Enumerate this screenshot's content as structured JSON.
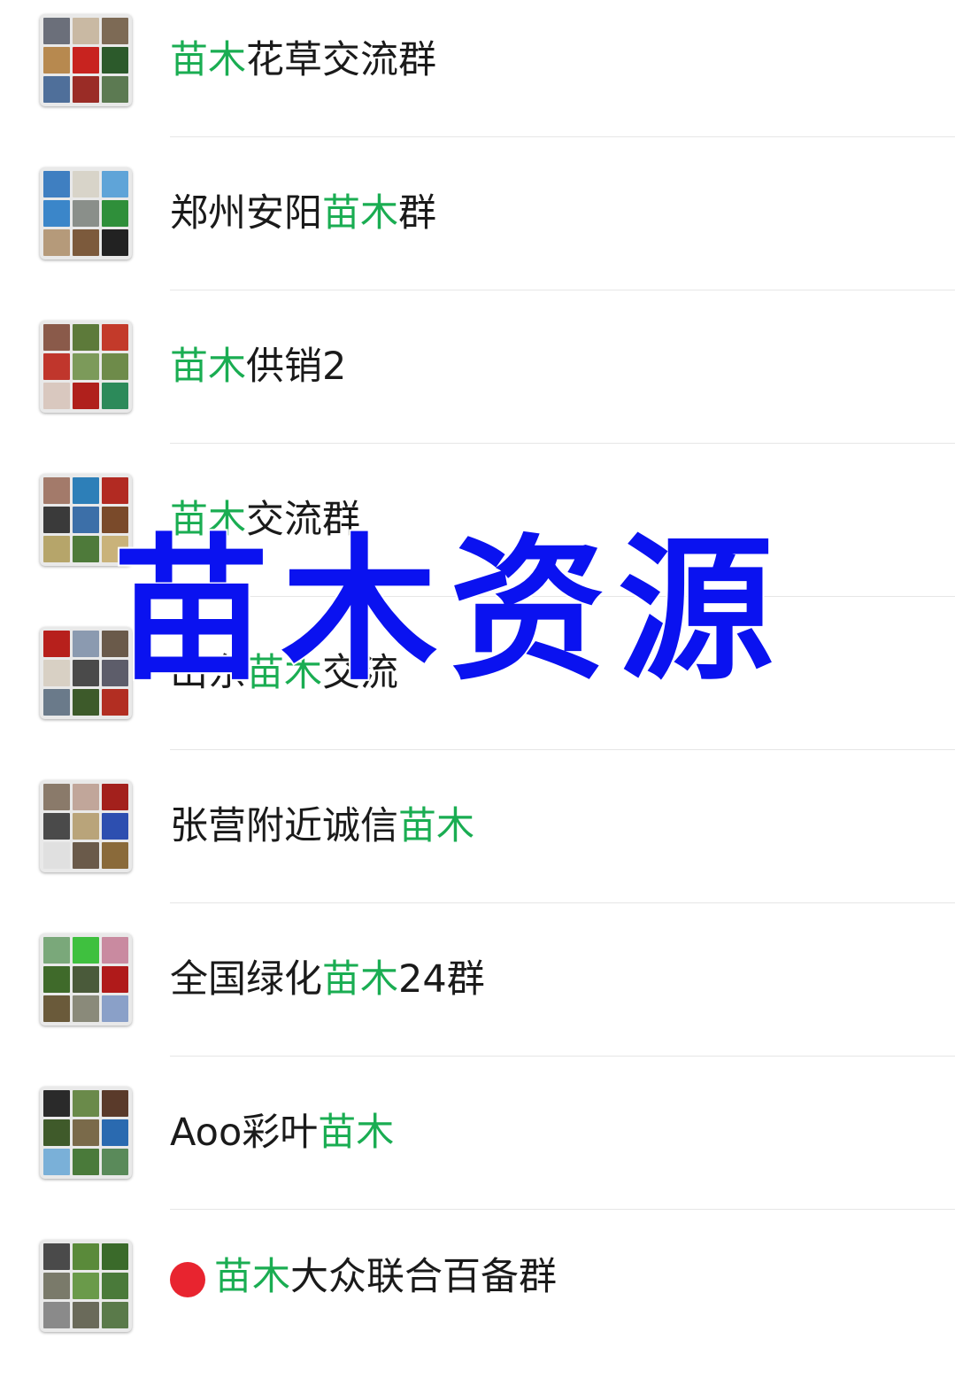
{
  "accent_color": "#1aad52",
  "watermark": {
    "text": "苗木资源",
    "color": "#0a12f0"
  },
  "groups": [
    {
      "pre": "",
      "hl": "苗木",
      "post": "花草交流群",
      "avatar_colors": [
        "#6b6f7a",
        "#c9b9a3",
        "#7d6a55",
        "#b7894f",
        "#c8231f",
        "#2c5a2b",
        "#4f6f9a",
        "#9a2c26",
        "#5c7a52"
      ]
    },
    {
      "pre": "郑州安阳",
      "hl": "苗木",
      "post": "群",
      "avatar_colors": [
        "#3f7fc1",
        "#d8d4c9",
        "#5fa4d8",
        "#3b86c9",
        "#8a8f8a",
        "#2f8f3a",
        "#b59a7a",
        "#7c5a3c",
        "#222222"
      ]
    },
    {
      "pre": "",
      "hl": "苗木",
      "post": "供销2",
      "avatar_colors": [
        "#8a5a4a",
        "#5d7a3a",
        "#c33a2a",
        "#c0362c",
        "#7c9a5a",
        "#6e8b4a",
        "#d9c8bf",
        "#b0201c",
        "#2c8a5a"
      ]
    },
    {
      "pre": "",
      "hl": "苗木",
      "post": "交流群",
      "avatar_colors": [
        "#a37a6a",
        "#2d7fb8",
        "#b22a22",
        "#3a3a3a",
        "#3c6fa8",
        "#7a4a2a",
        "#b6a56a",
        "#4e7a3a",
        "#c9b27a"
      ]
    },
    {
      "pre": "山东",
      "hl": "苗木",
      "post": "交流",
      "avatar_colors": [
        "#b7201c",
        "#8b9ab0",
        "#6a5a4a",
        "#d8d0c4",
        "#4a4a4a",
        "#5d5d6a",
        "#6a7a8a",
        "#3d5a2a",
        "#b22e22"
      ]
    },
    {
      "pre": "张营附近诚信",
      "hl": "苗木",
      "post": "",
      "avatar_colors": [
        "#8a7a6a",
        "#c1a69a",
        "#a3201c",
        "#4a4a4a",
        "#b9a47a",
        "#2d4fb0",
        "#e0e0e0",
        "#6a5a4a",
        "#8a6a3a"
      ]
    },
    {
      "pre": "全国绿化",
      "hl": "苗木",
      "post": "24群",
      "avatar_colors": [
        "#7aa87a",
        "#3fc03f",
        "#c98aa0",
        "#3f6a2a",
        "#4a5a3a",
        "#b01a1a",
        "#6a5a3a",
        "#8a8a7a",
        "#8aa0c8"
      ]
    },
    {
      "pre": "Aoo彩叶",
      "hl": "苗木",
      "post": "",
      "avatar_colors": [
        "#2a2a2a",
        "#6a8a4a",
        "#5a3a2a",
        "#3f5a2a",
        "#7a6a4a",
        "#2a6ab0",
        "#7ab0d8",
        "#4a7a3a",
        "#5a8a5a"
      ]
    },
    {
      "pre": "",
      "hl": "苗木",
      "post": "大众联合百备群",
      "avatar_colors": [
        "#4a4a4a",
        "#5a8a3a",
        "#3a6a2a",
        "#7a7a6a",
        "#6a9a4a",
        "#4a7a3a",
        "#8a8a8a",
        "#6a6a5a",
        "#5a7a4a"
      ]
    }
  ]
}
